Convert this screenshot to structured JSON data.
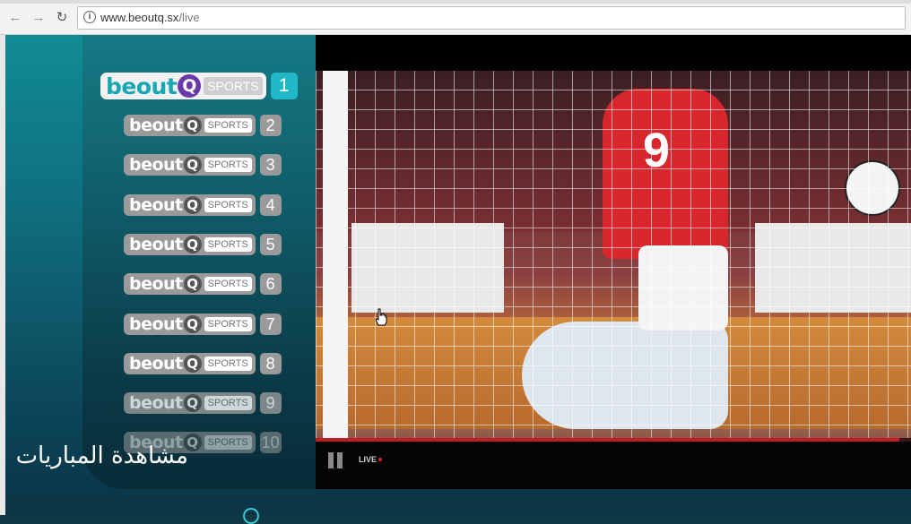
{
  "browser": {
    "url_host": "www.beoutq.sx",
    "url_path": "/live"
  },
  "brand": {
    "word": "beout",
    "q": "Q",
    "sports": "SPORTS"
  },
  "channels": [
    {
      "number": "1",
      "active": true
    },
    {
      "number": "2"
    },
    {
      "number": "3"
    },
    {
      "number": "4"
    },
    {
      "number": "5"
    },
    {
      "number": "6"
    },
    {
      "number": "7"
    },
    {
      "number": "8"
    },
    {
      "number": "9"
    },
    {
      "number": "10"
    }
  ],
  "overlay_text": "مشاهدة المباريات",
  "player": {
    "jersey_number": "9",
    "live_label": "LIVE",
    "progress_fraction": 0.98
  },
  "colors": {
    "accent": "#20b8c6",
    "q_active": "#6b3aa8",
    "live_dot": "#e02020"
  }
}
